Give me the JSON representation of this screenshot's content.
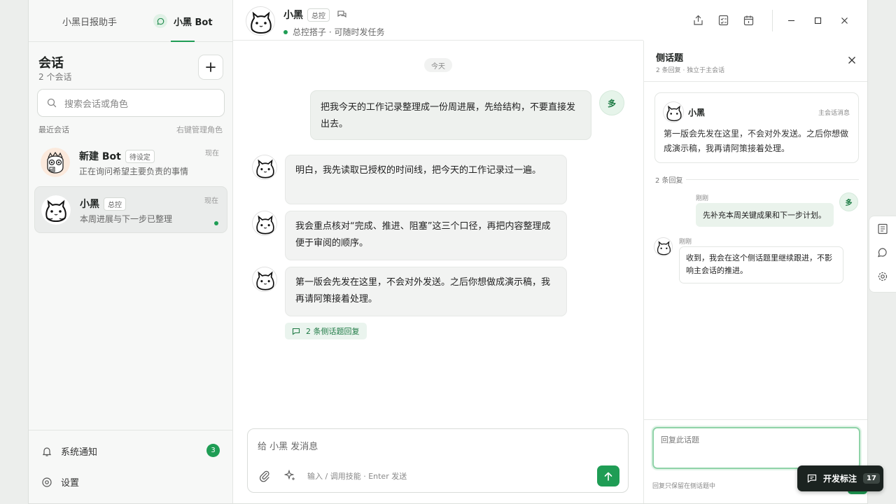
{
  "tabs": [
    {
      "label": "小黑日报助手"
    },
    {
      "label": "小黑 Bot"
    }
  ],
  "sidebar": {
    "title": "会话",
    "count": "2 个会话",
    "search_placeholder": "搜索会话或角色",
    "recent_label": "最近会话",
    "manage_hint": "右键管理角色",
    "conversations": [
      {
        "name": "新建 Bot",
        "badge": "待设定",
        "subtitle": "正在询问希望主要负责的事情",
        "time": "现在"
      },
      {
        "name": "小黑",
        "badge": "总控",
        "subtitle": "本周进展与下一步已整理",
        "time": "现在"
      }
    ],
    "footer": {
      "notifications_label": "系统通知",
      "notifications_count": "3",
      "settings_label": "设置"
    }
  },
  "chat": {
    "name": "小黑",
    "badge": "总控",
    "status": "总控搭子 · 可随时发任务",
    "date_divider": "今天",
    "user_avatar_label": "多",
    "messages": [
      {
        "role": "user",
        "text": "把我今天的工作记录整理成一份周进展，先给结构，不要直接发出去。"
      },
      {
        "role": "bot",
        "text": "明白，我先读取已授权的时间线，把今天的工作记录过一遍。"
      },
      {
        "role": "bot",
        "text": "我会重点核对“完成、推进、阻塞”这三个口径，再把内容整理成便于审阅的顺序。"
      },
      {
        "role": "bot",
        "text": "第一版会先发在这里，不会对外发送。之后你想做成演示稿，我再请阿策接着处理。"
      }
    ],
    "thread_replies_label": "2 条侧话题回复",
    "composer": {
      "placeholder": "给 小黑 发消息",
      "hint": "输入 / 调用技能 · Enter 发送"
    }
  },
  "side_thread": {
    "title": "侧话题",
    "subtitle": "2 条回复 · 独立于主会话",
    "origin": {
      "name": "小黑",
      "tag": "主会话消息",
      "text": "第一版会先发在这里，不会对外发送。之后你想做成演示稿，我再请阿策接着处理。"
    },
    "reply_count": "2 条回复",
    "replies": [
      {
        "role": "user",
        "time": "刚刚",
        "avatar_label": "多",
        "text": "先补充本周关键成果和下一步计划。"
      },
      {
        "role": "bot",
        "time": "刚刚",
        "text": "收到，我会在这个侧话题里继续跟进，不影响主会话的推进。"
      }
    ],
    "reply_placeholder": "回复此话题",
    "note": "回复只保留在侧话题中"
  },
  "dev_badge": {
    "label": "开发标注",
    "count": "17"
  },
  "colors": {
    "accent": "#1f9d55",
    "accent_soft": "#eaf4ee",
    "dark": "#1b2320"
  }
}
